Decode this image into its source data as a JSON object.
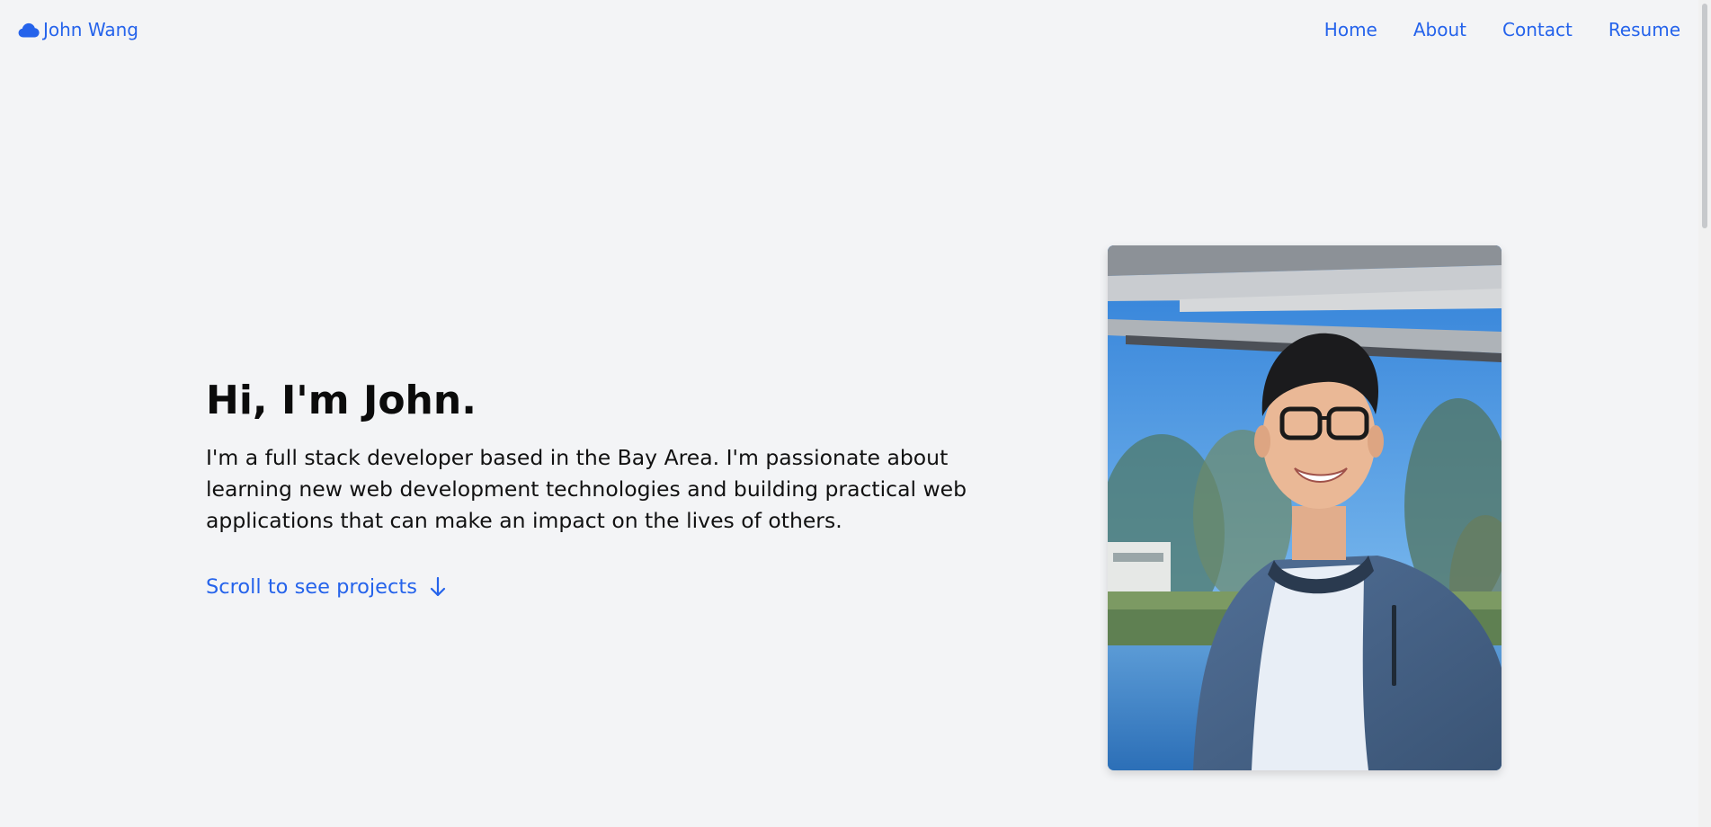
{
  "header": {
    "brand": {
      "icon": "cloud-icon",
      "name": "John Wang"
    },
    "nav": [
      {
        "label": "Home"
      },
      {
        "label": "About"
      },
      {
        "label": "Contact"
      },
      {
        "label": "Resume"
      }
    ]
  },
  "hero": {
    "title": "Hi, I'm John.",
    "description": "I'm a full stack developer based in the Bay Area. I'm passionate about learning new web development technologies and building practical web applications that can make an impact on the lives of others.",
    "scroll_link": {
      "label": "Scroll to see projects",
      "icon": "arrow-down-icon"
    }
  },
  "colors": {
    "accent": "#2563eb",
    "background": "#f3f4f6",
    "text": "#111111"
  }
}
